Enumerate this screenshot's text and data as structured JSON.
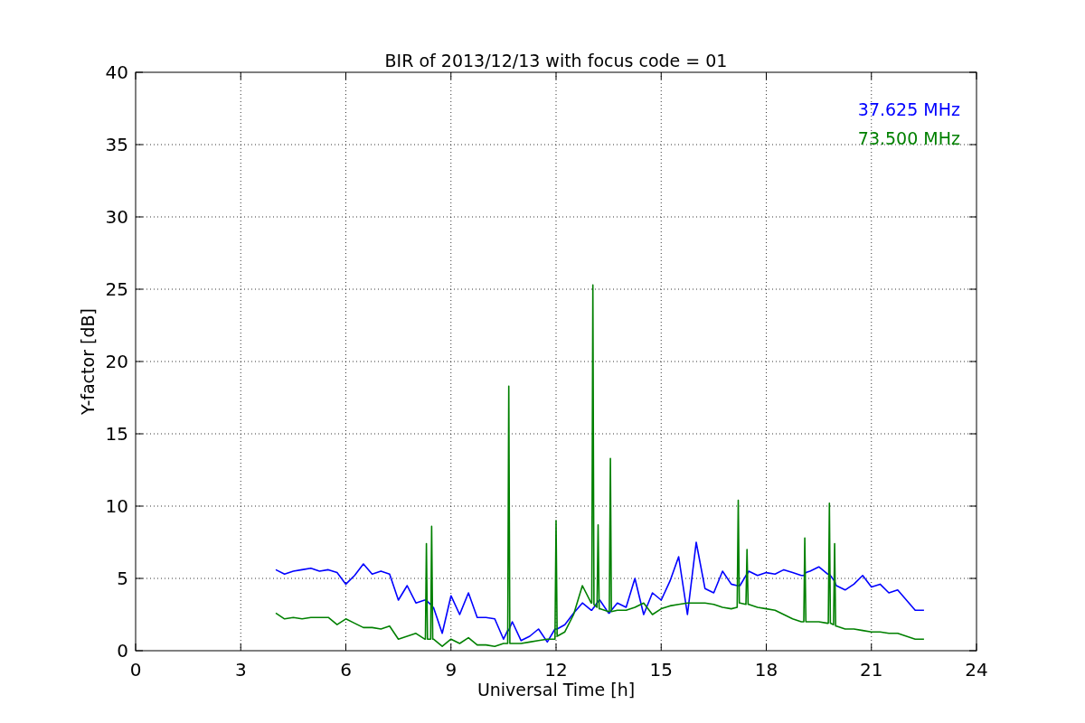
{
  "figure": {
    "chart_data": {
      "type": "line",
      "title": "BIR of 2013/12/13 with focus code = 01",
      "xlabel": "Universal Time [h]",
      "ylabel": "Y-factor [dB]",
      "grid": true,
      "xlim": [
        0,
        24
      ],
      "ylim": [
        0,
        40
      ],
      "xticks": [
        0,
        3,
        6,
        9,
        12,
        15,
        18,
        21,
        24
      ],
      "yticks": [
        0,
        5,
        10,
        15,
        20,
        25,
        30,
        35,
        40
      ],
      "x": [
        4,
        4.25,
        4.5,
        4.75,
        5,
        5.25,
        5.5,
        5.75,
        6,
        6.25,
        6.5,
        6.75,
        7,
        7.25,
        7.5,
        7.75,
        8,
        8.25,
        8.27,
        8.3,
        8.33,
        8.42,
        8.45,
        8.48,
        8.5,
        8.75,
        9,
        9.25,
        9.5,
        9.75,
        10,
        10.25,
        10.5,
        10.62,
        10.65,
        10.68,
        10.75,
        11,
        11.25,
        11.5,
        11.75,
        11.97,
        12,
        12.03,
        12.25,
        12.5,
        12.75,
        13,
        13.02,
        13.05,
        13.08,
        13.17,
        13.2,
        13.23,
        13.25,
        13.5,
        13.52,
        13.55,
        13.58,
        13.75,
        14,
        14.25,
        14.5,
        14.75,
        15,
        15.25,
        15.5,
        15.75,
        16,
        16.25,
        16.5,
        16.75,
        17,
        17.17,
        17.2,
        17.23,
        17.25,
        17.42,
        17.45,
        17.48,
        17.5,
        17.75,
        18,
        18.25,
        18.5,
        18.75,
        19,
        19.07,
        19.1,
        19.13,
        19.25,
        19.5,
        19.75,
        19.77,
        19.8,
        19.83,
        19.92,
        19.95,
        19.98,
        20,
        20.25,
        20.5,
        20.75,
        21,
        21.25,
        21.5,
        21.75,
        22,
        22.25,
        22.5
      ],
      "series": [
        {
          "name": "37.625 MHz",
          "color": "#0000ff",
          "values": [
            5.6,
            5.3,
            5.5,
            5.6,
            5.7,
            5.5,
            5.6,
            5.4,
            4.6,
            5.2,
            6.0,
            5.3,
            5.5,
            5.3,
            3.5,
            4.5,
            3.3,
            3.5,
            3.5,
            3.5,
            3.4,
            3.2,
            3.1,
            3.0,
            3.0,
            1.2,
            3.8,
            2.5,
            4.0,
            2.3,
            2.3,
            2.2,
            0.8,
            1.4,
            1.4,
            1.6,
            2.0,
            0.7,
            1.0,
            1.5,
            0.6,
            1.5,
            1.5,
            1.5,
            1.8,
            2.6,
            3.3,
            2.8,
            2.8,
            2.9,
            3.0,
            3.3,
            3.4,
            3.5,
            3.5,
            2.6,
            2.6,
            2.7,
            2.8,
            3.3,
            3.0,
            5.0,
            2.5,
            4.0,
            3.5,
            4.8,
            6.5,
            2.5,
            7.5,
            4.3,
            4.0,
            5.5,
            4.6,
            4.5,
            4.5,
            4.5,
            4.5,
            5.2,
            5.3,
            5.4,
            5.5,
            5.2,
            5.4,
            5.3,
            5.6,
            5.4,
            5.2,
            5.2,
            5.3,
            5.4,
            5.5,
            5.8,
            5.3,
            5.3,
            5.3,
            5.2,
            4.9,
            4.8,
            4.6,
            4.5,
            4.2,
            4.6,
            5.2,
            4.4,
            4.6,
            4.0,
            4.2,
            3.5,
            2.8,
            2.8
          ]
        },
        {
          "name": "73.500 MHz",
          "color": "#008000",
          "values": [
            2.6,
            2.2,
            2.3,
            2.2,
            2.3,
            2.3,
            2.3,
            1.8,
            2.2,
            1.9,
            1.6,
            1.6,
            1.5,
            1.7,
            0.8,
            1.0,
            1.2,
            0.8,
            0.8,
            7.4,
            0.8,
            0.8,
            8.6,
            0.8,
            0.8,
            0.3,
            0.8,
            0.5,
            0.9,
            0.4,
            0.4,
            0.3,
            0.5,
            0.5,
            18.3,
            0.5,
            0.5,
            0.5,
            0.6,
            0.7,
            0.8,
            0.8,
            9.0,
            1.0,
            1.3,
            2.5,
            4.5,
            3.3,
            3.3,
            25.3,
            3.2,
            3.0,
            8.7,
            2.9,
            2.9,
            2.7,
            2.7,
            13.3,
            2.7,
            2.8,
            2.8,
            3.0,
            3.3,
            2.5,
            2.9,
            3.1,
            3.2,
            3.3,
            3.3,
            3.3,
            3.2,
            3.0,
            2.9,
            3.0,
            10.4,
            3.3,
            3.3,
            3.2,
            7.0,
            3.2,
            3.2,
            3.0,
            2.9,
            2.8,
            2.5,
            2.2,
            2.0,
            2.0,
            7.8,
            2.0,
            2.0,
            2.0,
            1.9,
            1.9,
            10.2,
            1.9,
            1.8,
            7.4,
            1.7,
            1.7,
            1.5,
            1.5,
            1.4,
            1.3,
            1.3,
            1.2,
            1.2,
            1.0,
            0.8,
            0.8
          ]
        }
      ]
    }
  }
}
